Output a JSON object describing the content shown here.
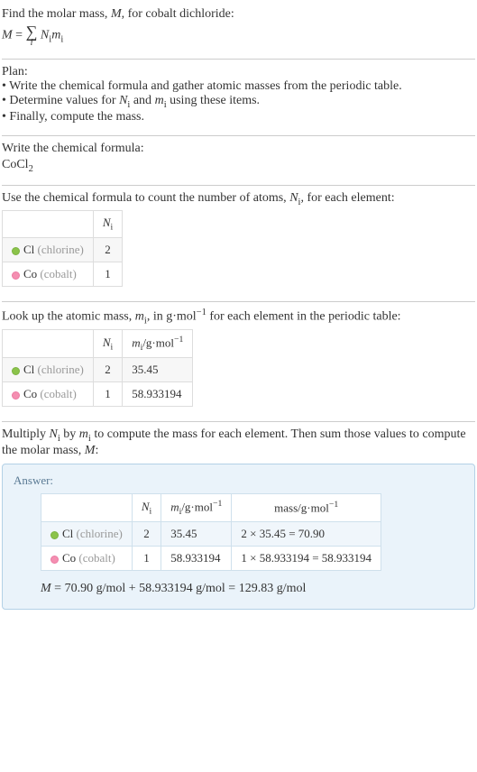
{
  "intro": {
    "line1": "Find the molar mass, ",
    "Mvar": "M",
    "line1b": ", for cobalt dichloride:",
    "eq_lhs": "M",
    "eq_eq": " = ",
    "sigma": "∑",
    "sigma_sub": "i",
    "eq_rhs_a": "N",
    "eq_rhs_a_sub": "i",
    "eq_rhs_b": "m",
    "eq_rhs_b_sub": "i"
  },
  "plan": {
    "heading": "Plan:",
    "b1": "• Write the chemical formula and gather atomic masses from the periodic table.",
    "b2_a": "• Determine values for ",
    "b2_N": "N",
    "b2_Ni": "i",
    "b2_and": " and ",
    "b2_m": "m",
    "b2_mi": "i",
    "b2_b": " using these items.",
    "b3": "• Finally, compute the mass."
  },
  "formula_sec": {
    "heading": "Write the chemical formula:",
    "formula_a": "CoCl",
    "formula_sub": "2"
  },
  "count_sec": {
    "line_a": "Use the chemical formula to count the number of atoms, ",
    "N": "N",
    "Ni": "i",
    "line_b": ", for each element:",
    "hdr_N": "N",
    "hdr_Ni": "i",
    "row_cl_sym": "Cl",
    "row_cl_name": "(chlorine)",
    "row_cl_N": "2",
    "row_co_sym": "Co",
    "row_co_name": "(cobalt)",
    "row_co_N": "1"
  },
  "mass_sec": {
    "line_a": "Look up the atomic mass, ",
    "m": "m",
    "mi": "i",
    "line_b": ", in g·mol",
    "exp": "−1",
    "line_c": " for each element in the periodic table:",
    "hdr_N": "N",
    "hdr_Ni": "i",
    "hdr_m": "m",
    "hdr_mi": "i",
    "hdr_unit_a": "/g·mol",
    "hdr_unit_exp": "−1",
    "row_cl_sym": "Cl",
    "row_cl_name": "(chlorine)",
    "row_cl_N": "2",
    "row_cl_m": "35.45",
    "row_co_sym": "Co",
    "row_co_name": "(cobalt)",
    "row_co_N": "1",
    "row_co_m": "58.933194"
  },
  "mult_sec": {
    "line_a": "Multiply ",
    "N": "N",
    "Ni": "i",
    "by": " by ",
    "m": "m",
    "mi": "i",
    "line_b": " to compute the mass for each element. Then sum those values to compute the molar mass, ",
    "M": "M",
    "colon": ":"
  },
  "answer": {
    "label": "Answer:",
    "hdr_N": "N",
    "hdr_Ni": "i",
    "hdr_m": "m",
    "hdr_mi": "i",
    "hdr_munit": "/g·mol",
    "hdr_munit_exp": "−1",
    "hdr_mass": "mass/g·mol",
    "hdr_mass_exp": "−1",
    "row_cl_sym": "Cl",
    "row_cl_name": "(chlorine)",
    "row_cl_N": "2",
    "row_cl_m": "35.45",
    "row_cl_mass": "2 × 35.45 = 70.90",
    "row_co_sym": "Co",
    "row_co_name": "(cobalt)",
    "row_co_N": "1",
    "row_co_m": "58.933194",
    "row_co_mass": "1 × 58.933194 = 58.933194",
    "final_M": "M",
    "final_eq": " = 70.90 g/mol + 58.933194 g/mol = 129.83 g/mol"
  }
}
